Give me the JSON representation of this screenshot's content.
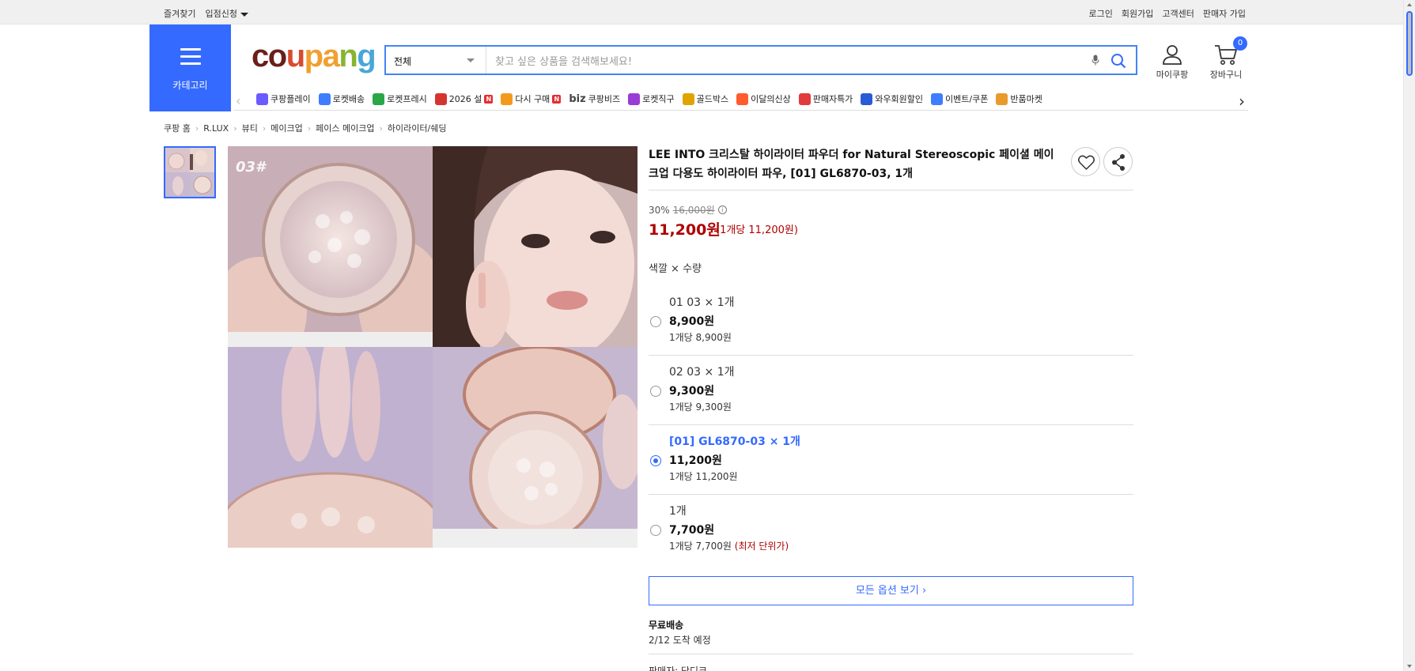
{
  "topbar": {
    "bookmark": "즐겨찾기",
    "store_apply": "입점신청",
    "login": "로그인",
    "signup": "회원가입",
    "customer_center": "고객센터",
    "seller_signup": "판매자 가입"
  },
  "header": {
    "category_label": "카테고리",
    "logo_parts": [
      "c",
      "o",
      "u",
      "p",
      "a",
      "n",
      "g"
    ],
    "search_scope": "전체",
    "search_placeholder": "찾고 싶은 상품을 검색해보세요!",
    "my_coupang": "마이쿠팡",
    "cart": "장바구니",
    "cart_count": "0"
  },
  "nav": {
    "items": [
      {
        "label": "쿠팡플레이",
        "icon": "play-icon",
        "color": "#6a5cff"
      },
      {
        "label": "로켓배송",
        "icon": "rocket-icon",
        "color": "#3f7cff"
      },
      {
        "label": "로켓프레시",
        "icon": "rocket-fresh-icon",
        "color": "#29a745"
      },
      {
        "label": "2026 설",
        "icon": "gift-icon",
        "color": "#d6342e",
        "badge": "N"
      },
      {
        "label": "다시 구매",
        "icon": "basket-icon",
        "color": "#f39a1c",
        "badge": "N"
      },
      {
        "label": "쿠팡비즈",
        "icon": "biz-icon",
        "color": "#444",
        "prefix": "biz"
      },
      {
        "label": "로켓직구",
        "icon": "global-rocket-icon",
        "color": "#9a3bd6"
      },
      {
        "label": "골드박스",
        "icon": "goldbox-icon",
        "color": "#e0a400"
      },
      {
        "label": "이달의신상",
        "icon": "new-bag-icon",
        "color": "#ff5b2e"
      },
      {
        "label": "판매자특가",
        "icon": "discount-icon",
        "color": "#e23b3b"
      },
      {
        "label": "와우회원할인",
        "icon": "wow-icon",
        "color": "#2a5bd7"
      },
      {
        "label": "이벤트/쿠폰",
        "icon": "coupon-icon",
        "color": "#3f7cff"
      },
      {
        "label": "반품마켓",
        "icon": "market-icon",
        "color": "#e89b2a"
      }
    ]
  },
  "breadcrumb": [
    "쿠팡 홈",
    "R.LUX",
    "뷰티",
    "메이크업",
    "페이스 메이크업",
    "하이라이터/쉐딩"
  ],
  "product": {
    "title": "LEE INTO 크리스탈 하이라이터 파우더 for Natural Stereoscopic 페이셜 메이크업 다용도 하이라이터 파우, [01] GL6870-03, 1개",
    "image_label": "03#",
    "discount_rate": "30%",
    "original_price": "16,000원",
    "price": "11,200원",
    "unit_price": "(1개당 11,200원)",
    "option_label": "색깔 × 수량",
    "options": [
      {
        "name": "01 03 × 1개",
        "price": "8,900원",
        "unit": "1개당 8,900원",
        "low": ""
      },
      {
        "name": "02 03 × 1개",
        "price": "9,300원",
        "unit": "1개당 9,300원",
        "low": ""
      },
      {
        "name": "[01] GL6870-03 × 1개",
        "price": "11,200원",
        "unit": "1개당 11,200원",
        "low": ""
      },
      {
        "name": "1개",
        "price": "7,700원",
        "unit": "1개당 7,700원",
        "low": "(최저 단위가)"
      }
    ],
    "selected_option": 2,
    "all_options": "모든 옵션 보기 ›",
    "shipping_title": "무료배송",
    "shipping_eta": "2/12 도착 예정",
    "seller_partial": "판매자: 당디크"
  },
  "colors": {
    "accent": "#346aff",
    "price": "#ae0000",
    "search_border": "#4285f4"
  }
}
